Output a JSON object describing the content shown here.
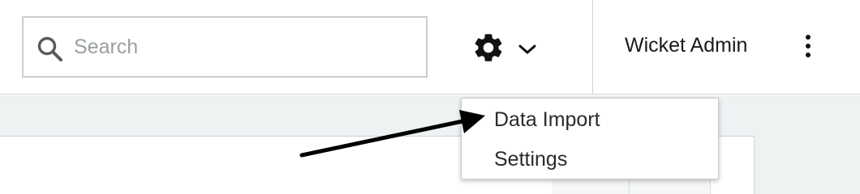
{
  "header": {
    "search": {
      "placeholder": "Search",
      "value": "",
      "icon": "search-icon"
    },
    "gear_menu": {
      "icon": "gear-icon",
      "caret_icon": "chevron-down-icon"
    },
    "user": {
      "name": "Wicket Admin",
      "menu_icon": "kebab-icon"
    }
  },
  "dropdown": {
    "items": [
      {
        "label": "Data Import"
      },
      {
        "label": "Settings"
      }
    ]
  },
  "annotation": {
    "icon": "arrow",
    "color": "#000000",
    "target": "Data Import"
  },
  "colors": {
    "subbar_background": "#eef2f3",
    "border": "#cfd3d6",
    "text": "#1b1b1b"
  }
}
